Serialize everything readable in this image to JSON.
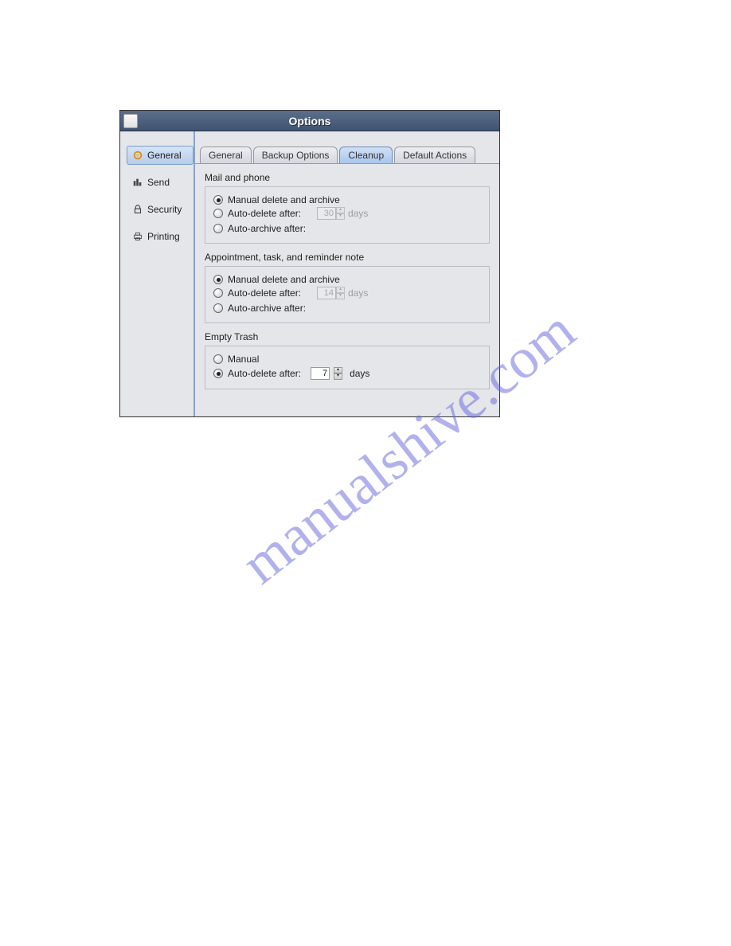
{
  "watermark": "manualshive.com",
  "window": {
    "title": "Options"
  },
  "sidebar": {
    "items": [
      {
        "label": "General",
        "selected": true
      },
      {
        "label": "Send"
      },
      {
        "label": "Security"
      },
      {
        "label": "Printing"
      }
    ]
  },
  "tabs": [
    {
      "label": "General"
    },
    {
      "label": "Backup Options"
    },
    {
      "label": "Cleanup",
      "active": true
    },
    {
      "label": "Default Actions"
    }
  ],
  "groups": {
    "mailphone": {
      "title": "Mail and phone",
      "options": {
        "manual": "Manual delete and archive",
        "autodelete": "Auto-delete after:",
        "autoarchive": "Auto-archive after:"
      },
      "selected": "manual",
      "value": "30",
      "unit": "days"
    },
    "atr": {
      "title": "Appointment, task, and reminder note",
      "options": {
        "manual": "Manual delete and archive",
        "autodelete": "Auto-delete after:",
        "autoarchive": "Auto-archive after:"
      },
      "selected": "manual",
      "value": "14",
      "unit": "days"
    },
    "trash": {
      "title": "Empty Trash",
      "options": {
        "manual": "Manual",
        "autodelete": "Auto-delete after:"
      },
      "selected": "autodelete",
      "value": "7",
      "unit": "days"
    }
  }
}
